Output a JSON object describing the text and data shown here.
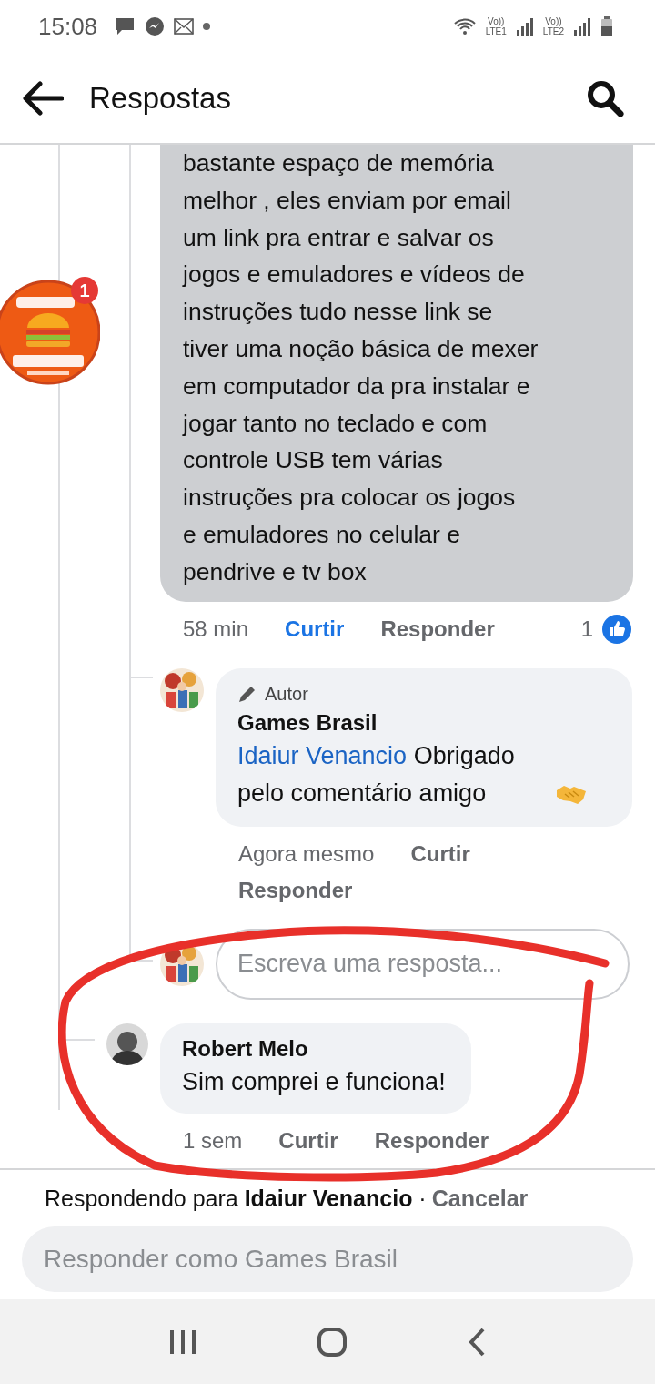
{
  "status_bar": {
    "time": "15:08",
    "sims": [
      {
        "voice": "Vo))",
        "network": "LTE1"
      },
      {
        "voice": "Vo))",
        "network": "LTE2"
      }
    ]
  },
  "header": {
    "title": "Respostas"
  },
  "comment": {
    "badge": "1",
    "text": "bastante espaço de memória\nmelhor , eles enviam por email\num link pra entrar e salvar os\njogos e emuladores e vídeos de\ninstruções tudo nesse link  se\ntiver uma noção básica de mexer\nem computador da pra instalar e\njogar tanto no teclado e com\ncontrole USB tem várias\ninstruções pra colocar os jogos\ne emuladores no celular e\npendrive e tv box",
    "time": "58 min",
    "like": {
      "label": "Curtir",
      "selected": true
    },
    "reply": "Responder",
    "reaction_count": "1"
  },
  "author_reply": {
    "badge": "Autor",
    "name": "Games Brasil",
    "mention": "Idaiur Venancio",
    "text": "Obrigado pelo comentário amigo",
    "time": "Agora mesmo",
    "like": {
      "label": "Curtir",
      "selected": false
    },
    "reply": "Responder"
  },
  "write_reply": {
    "placeholder": "Escreva uma resposta..."
  },
  "other_reply": {
    "name": "Robert Melo",
    "text": "Sim comprei e funciona!",
    "time": "1 sem",
    "like": {
      "label": "Curtir",
      "selected": false
    },
    "reply": "Responder"
  },
  "replying_to": {
    "text": "Respondendo para **Idaiur Venancio** ·",
    "cancel": "Cancelar"
  },
  "composer": {
    "placeholder": "Responder como Games Brasil"
  }
}
